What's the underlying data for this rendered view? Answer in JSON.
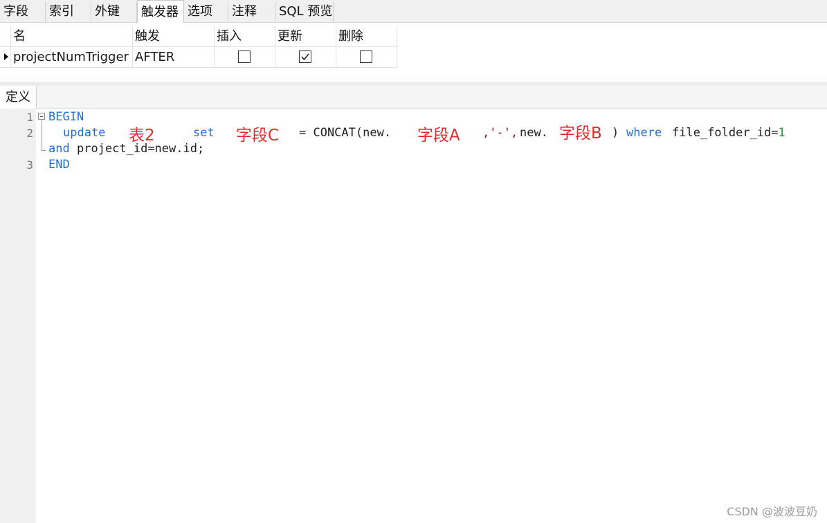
{
  "tabs": [
    {
      "label": "字段",
      "active": false
    },
    {
      "label": "索引",
      "active": false
    },
    {
      "label": "外键",
      "active": false
    },
    {
      "label": "触发器",
      "active": true
    },
    {
      "label": "选项",
      "active": false
    },
    {
      "label": "注释",
      "active": false
    },
    {
      "label": "SQL 预览",
      "active": false
    }
  ],
  "trigger_grid": {
    "headers": [
      "名",
      "触发",
      "插入",
      "更新",
      "删除"
    ],
    "rows": [
      {
        "name": "projectNumTrigger",
        "timing": "AFTER",
        "insert": false,
        "update": true,
        "delete": false
      }
    ]
  },
  "definition": {
    "tab_label": "定义",
    "line_numbers": [
      "1",
      "2",
      "3"
    ],
    "code": {
      "line1_kw": "BEGIN",
      "line2_update": "update",
      "line2_set": "set",
      "line2_concat": "= CONCAT(new.",
      "line2_sep": ",'-',",
      "line2_new": "new.",
      "line2_close": ")",
      "line2_where": "where",
      "line2_cond": "file_folder_id=",
      "line2_num": "1",
      "line2b_and": "and",
      "line2b_rest": "project_id=new.id;",
      "line3_kw": "END"
    },
    "annotations": {
      "table": "表2",
      "field_c": "字段C",
      "field_a": "字段A",
      "field_b": "字段B"
    }
  },
  "watermark": "CSDN @波波豆奶",
  "colors": {
    "keyword": "#1f6fd6",
    "annotation": "#e8272a",
    "number": "#13a52a"
  }
}
